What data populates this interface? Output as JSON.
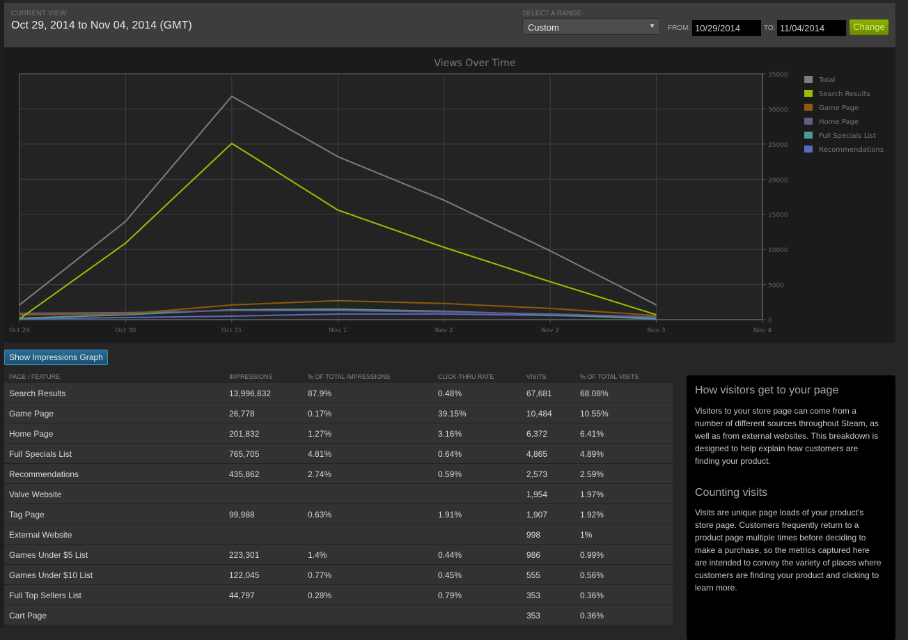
{
  "header": {
    "current_view_label": "CURRENT VIEW",
    "current_view_value": "Oct 29, 2014 to Nov 04, 2014 (GMT)",
    "range_label": "SELECT A RANGE",
    "range_selected": "Custom",
    "from_label": "FROM:",
    "from_value": "10/29/2014",
    "to_label": "TO:",
    "to_value": "11/04/2014",
    "change_label": "Change"
  },
  "chart_data": {
    "type": "line",
    "title": "Views Over Time",
    "xlabel": "",
    "ylabel": "",
    "x": [
      "Oct 29",
      "Oct 30",
      "Oct 31",
      "Nov 1",
      "Nov 2",
      "Nov 2",
      "Nov 3"
    ],
    "x_ticks": [
      "Oct 29",
      "Oct 30",
      "Oct 31",
      "Nov 1",
      "Nov 2",
      "Nov 2",
      "Nov 3",
      "Nov 4"
    ],
    "y_ticks": [
      0,
      5000,
      10000,
      15000,
      20000,
      25000,
      30000,
      35000
    ],
    "ylim": [
      0,
      35000
    ],
    "y_axis_side": "right",
    "grid": true,
    "legend_position": "right",
    "series": [
      {
        "name": "Total",
        "color": "#7d7d7d",
        "values": [
          2100,
          14000,
          31800,
          23200,
          17000,
          9800,
          2100
        ]
      },
      {
        "name": "Search Results",
        "color": "#98c000",
        "values": [
          100,
          10900,
          25100,
          15600,
          10300,
          5400,
          700
        ]
      },
      {
        "name": "Game Page",
        "color": "#8c5a0e",
        "values": [
          700,
          800,
          2100,
          2700,
          2300,
          1600,
          600
        ]
      },
      {
        "name": "Home Page",
        "color": "#6b5a8c",
        "values": [
          900,
          1000,
          1300,
          1300,
          1100,
          800,
          400
        ]
      },
      {
        "name": "Full Specials List",
        "color": "#4a9a9a",
        "values": [
          200,
          700,
          1400,
          1500,
          1200,
          700,
          100
        ]
      },
      {
        "name": "Recommendations",
        "color": "#5a68c8",
        "values": [
          100,
          300,
          500,
          800,
          800,
          600,
          300
        ]
      }
    ]
  },
  "impressions_button": "Show Impressions Graph",
  "table": {
    "headers": [
      "PAGE / FEATURE",
      "IMPRESSIONS",
      "% OF TOTAL IMPRESSIONS",
      "CLICK-THRU RATE",
      "VISITS",
      "% OF TOTAL VISITS"
    ],
    "rows": [
      [
        "Search Results",
        "13,996,832",
        "87.9%",
        "0.48%",
        "67,681",
        "68.08%"
      ],
      [
        "Game Page",
        "26,778",
        "0.17%",
        "39.15%",
        "10,484",
        "10.55%"
      ],
      [
        "Home Page",
        "201,832",
        "1.27%",
        "3.16%",
        "6,372",
        "6.41%"
      ],
      [
        "Full Specials List",
        "765,705",
        "4.81%",
        "0.64%",
        "4,865",
        "4.89%"
      ],
      [
        "Recommendations",
        "435,862",
        "2.74%",
        "0.59%",
        "2,573",
        "2.59%"
      ],
      [
        "Valve Website",
        "",
        "",
        "",
        "1,954",
        "1.97%"
      ],
      [
        "Tag Page",
        "99,988",
        "0.63%",
        "1.91%",
        "1,907",
        "1.92%"
      ],
      [
        "External Website",
        "",
        "",
        "",
        "998",
        "1%"
      ],
      [
        "Games Under $5 List",
        "223,301",
        "1.4%",
        "0.44%",
        "986",
        "0.99%"
      ],
      [
        "Games Under $10 List",
        "122,045",
        "0.77%",
        "0.45%",
        "555",
        "0.56%"
      ],
      [
        "Full Top Sellers List",
        "44,797",
        "0.28%",
        "0.79%",
        "353",
        "0.36%"
      ],
      [
        "Cart Page",
        "",
        "",
        "",
        "353",
        "0.36%"
      ]
    ]
  },
  "sidebar": {
    "heading1": "How visitors get to your page",
    "text1": "Visitors to your store page can come from a number of different sources throughout Steam, as well as from external websites. This breakdown is designed to help explain how customers are finding your product.",
    "heading2": "Counting visits",
    "text2": "Visits are unique page loads of your product's store page. Customers frequently return to a product page multiple times before deciding to make a purchase, so the metrics captured here are intended to convey the variety of places where customers are finding your product and clicking to learn more."
  }
}
